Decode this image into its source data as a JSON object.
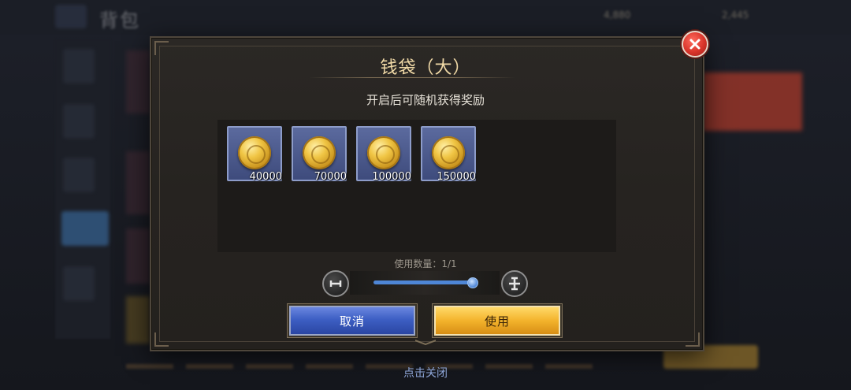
{
  "background": {
    "title": "背包",
    "resource_1": "4,880",
    "resource_2": "2,445"
  },
  "dialog": {
    "title": "钱袋（大）",
    "subtitle": "开启后可随机获得奖励",
    "rewards": [
      {
        "icon": "gold-coin-icon",
        "quantity": "40000"
      },
      {
        "icon": "gold-coin-icon",
        "quantity": "70000"
      },
      {
        "icon": "gold-coin-icon",
        "quantity": "100000"
      },
      {
        "icon": "gold-coin-icon",
        "quantity": "150000"
      }
    ],
    "use_count_label": "使用数量：1/1",
    "slider_value": 1,
    "slider_max": 1,
    "cancel_label": "取消",
    "use_label": "使用"
  },
  "footer": {
    "tap_to_close": "点击关闭"
  },
  "colors": {
    "title_gold": "#f0d9a6",
    "cancel_blue": "#3d5fc4",
    "use_gold": "#f3b32c",
    "close_red": "#d9342a",
    "slider_blue": "#4e86d6"
  }
}
